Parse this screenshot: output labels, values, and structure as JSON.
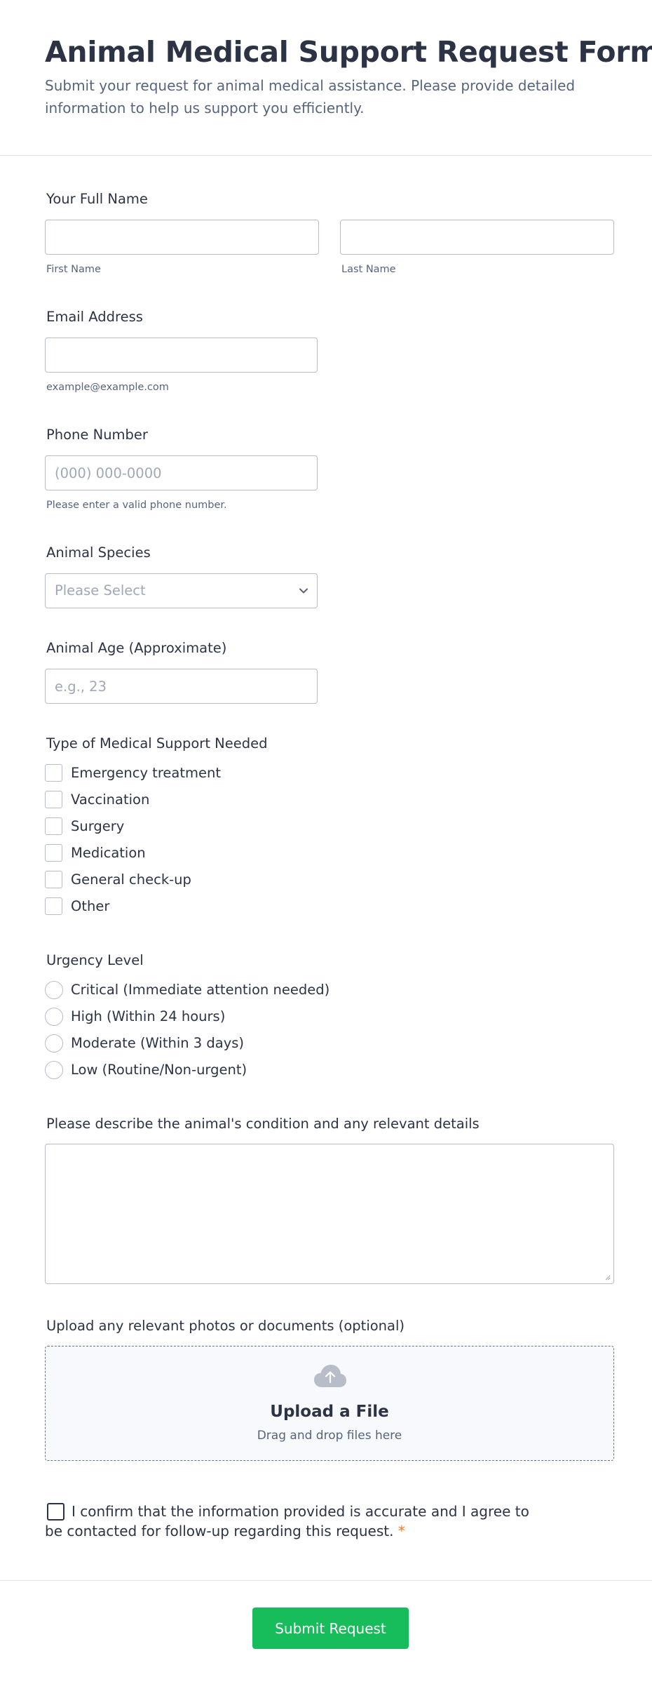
{
  "form": {
    "title": "Animal Medical Support Request Form",
    "subtitle": "Submit your request for animal medical assistance. Please provide detailed information to help us support you efficiently."
  },
  "full_name": {
    "label": "Your Full Name",
    "first_value": "",
    "first_sublabel": "First Name",
    "last_value": "",
    "last_sublabel": "Last Name"
  },
  "email": {
    "label": "Email Address",
    "value": "",
    "sublabel": "example@example.com"
  },
  "phone": {
    "label": "Phone Number",
    "placeholder": "(000) 000-0000",
    "sublabel": "Please enter a valid phone number."
  },
  "species": {
    "label": "Animal Species",
    "placeholder": "Please Select"
  },
  "age": {
    "label": "Animal Age (Approximate)",
    "placeholder": "e.g., 23"
  },
  "support_type": {
    "label": "Type of Medical Support Needed",
    "options": [
      "Emergency treatment",
      "Vaccination",
      "Surgery",
      "Medication",
      "General check-up",
      "Other"
    ]
  },
  "urgency": {
    "label": "Urgency Level",
    "options": [
      "Critical (Immediate attention needed)",
      "High (Within 24 hours)",
      "Moderate (Within 3 days)",
      "Low (Routine/Non-urgent)"
    ]
  },
  "description": {
    "label": "Please describe the animal's condition and any relevant details",
    "value": ""
  },
  "upload": {
    "label": "Upload any relevant photos or documents (optional)",
    "title": "Upload a File",
    "subtitle": "Drag and drop files here",
    "icon": "cloud-upload-icon"
  },
  "consent": {
    "text": "I confirm that the information provided is accurate and I agree to be contacted for follow-up regarding this request.",
    "required_mark": "*"
  },
  "submit_label": "Submit Request",
  "colors": {
    "text": "#2c3345",
    "muted": "#57647e",
    "border": "#b8bdc9",
    "submit": "#18bd5b",
    "required": "#f2792b"
  }
}
